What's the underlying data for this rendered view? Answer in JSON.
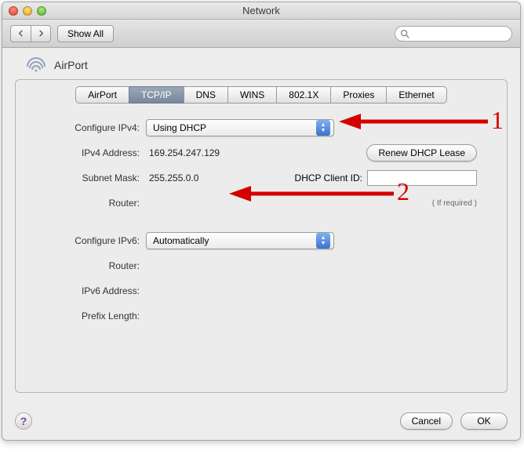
{
  "window": {
    "title": "Network"
  },
  "toolbar": {
    "show_all": "Show All",
    "search_placeholder": ""
  },
  "pane": {
    "title": "AirPort"
  },
  "tabs": [
    {
      "label": "AirPort",
      "active": false
    },
    {
      "label": "TCP/IP",
      "active": true
    },
    {
      "label": "DNS",
      "active": false
    },
    {
      "label": "WINS",
      "active": false
    },
    {
      "label": "802.1X",
      "active": false
    },
    {
      "label": "Proxies",
      "active": false
    },
    {
      "label": "Ethernet",
      "active": false
    }
  ],
  "ipv4": {
    "configure_label": "Configure IPv4:",
    "configure_value": "Using DHCP",
    "address_label": "IPv4 Address:",
    "address_value": "169.254.247.129",
    "subnet_label": "Subnet Mask:",
    "subnet_value": "255.255.0.0",
    "router_label": "Router:",
    "router_value": "",
    "renew_button": "Renew DHCP Lease",
    "dhcp_client_id_label": "DHCP Client ID:",
    "dhcp_client_id_value": "",
    "dhcp_client_id_note": "( If required )"
  },
  "ipv6": {
    "configure_label": "Configure IPv6:",
    "configure_value": "Automatically",
    "router_label": "Router:",
    "router_value": "",
    "address_label": "IPv6 Address:",
    "address_value": "",
    "prefix_label": "Prefix Length:",
    "prefix_value": ""
  },
  "buttons": {
    "cancel": "Cancel",
    "ok": "OK"
  },
  "annotations": {
    "one": "1",
    "two": "2"
  }
}
